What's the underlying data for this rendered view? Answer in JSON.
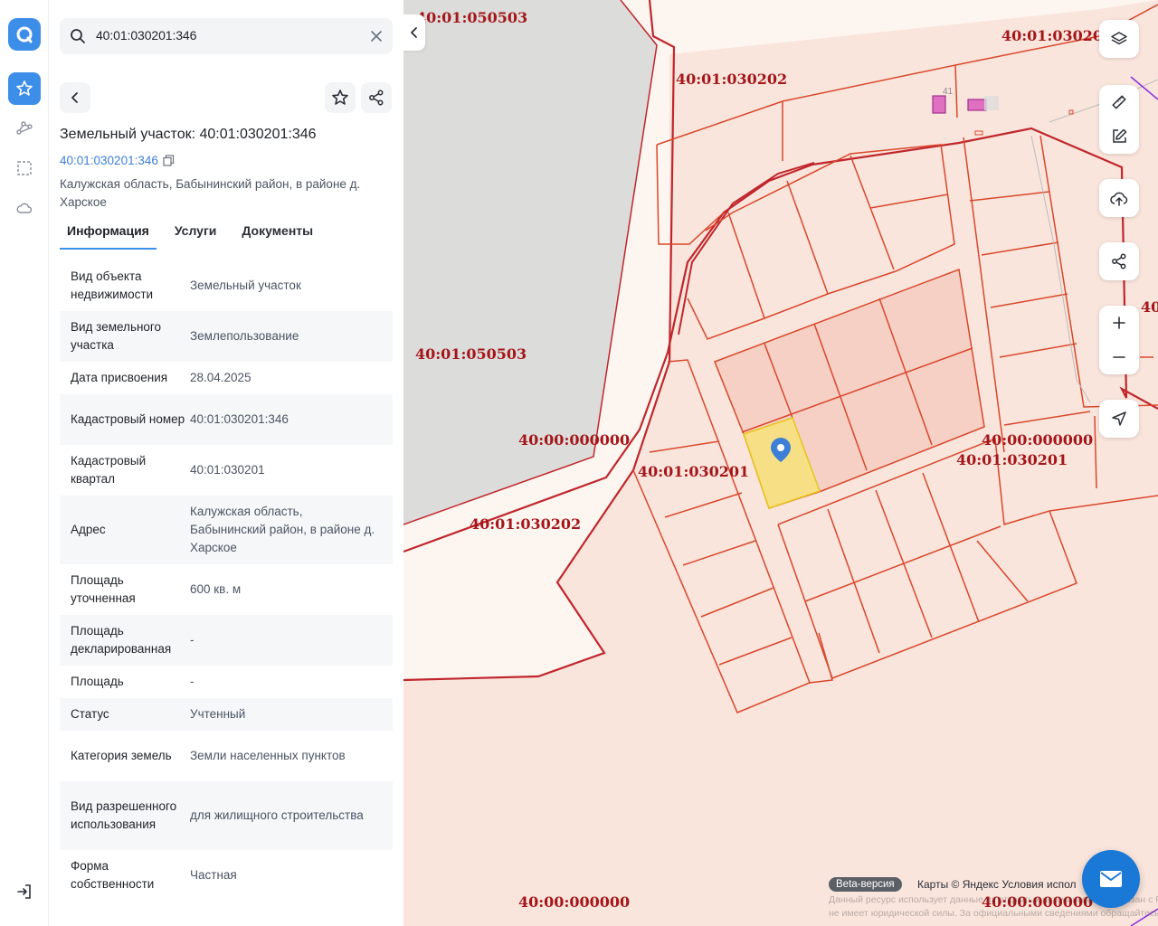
{
  "search": {
    "value": "40:01:030201:346"
  },
  "details": {
    "title": "Земельный участок: 40:01:030201:346",
    "cad_link": "40:01:030201:346",
    "address_line": "Калужская область, Бабынинский район, в районе д. Харское"
  },
  "tabs": [
    {
      "label": "Информация",
      "active": true
    },
    {
      "label": "Услуги",
      "active": false
    },
    {
      "label": "Документы",
      "active": false
    }
  ],
  "info_rows": [
    {
      "key": "Вид объекта недвижимости",
      "value": "Земельный участок"
    },
    {
      "key": "Вид земельного участка",
      "value": "Землепользование"
    },
    {
      "key": "Дата присвоения",
      "value": "28.04.2025"
    },
    {
      "key": "Кадастровый номер",
      "value": "40:01:030201:346"
    },
    {
      "key": "Кадастровый квартал",
      "value": "40:01:030201"
    },
    {
      "key": "Адрес",
      "value": "Калужская область, Бабынинский район, в районе д. Харское"
    },
    {
      "key": "Площадь уточненная",
      "value": "600 кв. м"
    },
    {
      "key": "Площадь декларированная",
      "value": "-"
    },
    {
      "key": "Площадь",
      "value": "-"
    },
    {
      "key": "Статус",
      "value": "Учтенный"
    },
    {
      "key": "Категория земель",
      "value": "Земли населенных пунктов"
    },
    {
      "key": "Вид разрешенного использования",
      "value": "для жилищного строительства"
    },
    {
      "key": "Форма собственности",
      "value": "Частная"
    }
  ],
  "map": {
    "labels": {
      "q050503_top": "40:01:050503",
      "q050503_mid": "40:01:050503",
      "q030202_top": "40:01:030202",
      "q030202_bottom": "40:01:030202",
      "q030202_right": "40:01:03020",
      "q000000_left": "40:00:000000",
      "q000000_right": "40:00:000000",
      "q000000_bottom_left": "40:00:000000",
      "q000000_bottom_right": "40:00:000000",
      "q030201_left": "40:01:030201",
      "q030201_right": "40:01:030201",
      "q40_edge": "40",
      "building_number": "41"
    },
    "beta_badge": "Beta-версия",
    "attribution": "Карты © Яндекс   Условия испол",
    "disclaimer": "Данный ресурс использует данные из открытых источников и не связан с Росреестром. Вся информация не гарантирует точность и не имеет юридической силы. За официальными сведениями обращайтесь в Росреестр."
  },
  "colors": {
    "accent": "#3d8ee8",
    "parcel_border": "#d9472b",
    "quarter_border": "#c0262c",
    "selected_parcel": "#f6e27a",
    "label": "#a4161a"
  }
}
